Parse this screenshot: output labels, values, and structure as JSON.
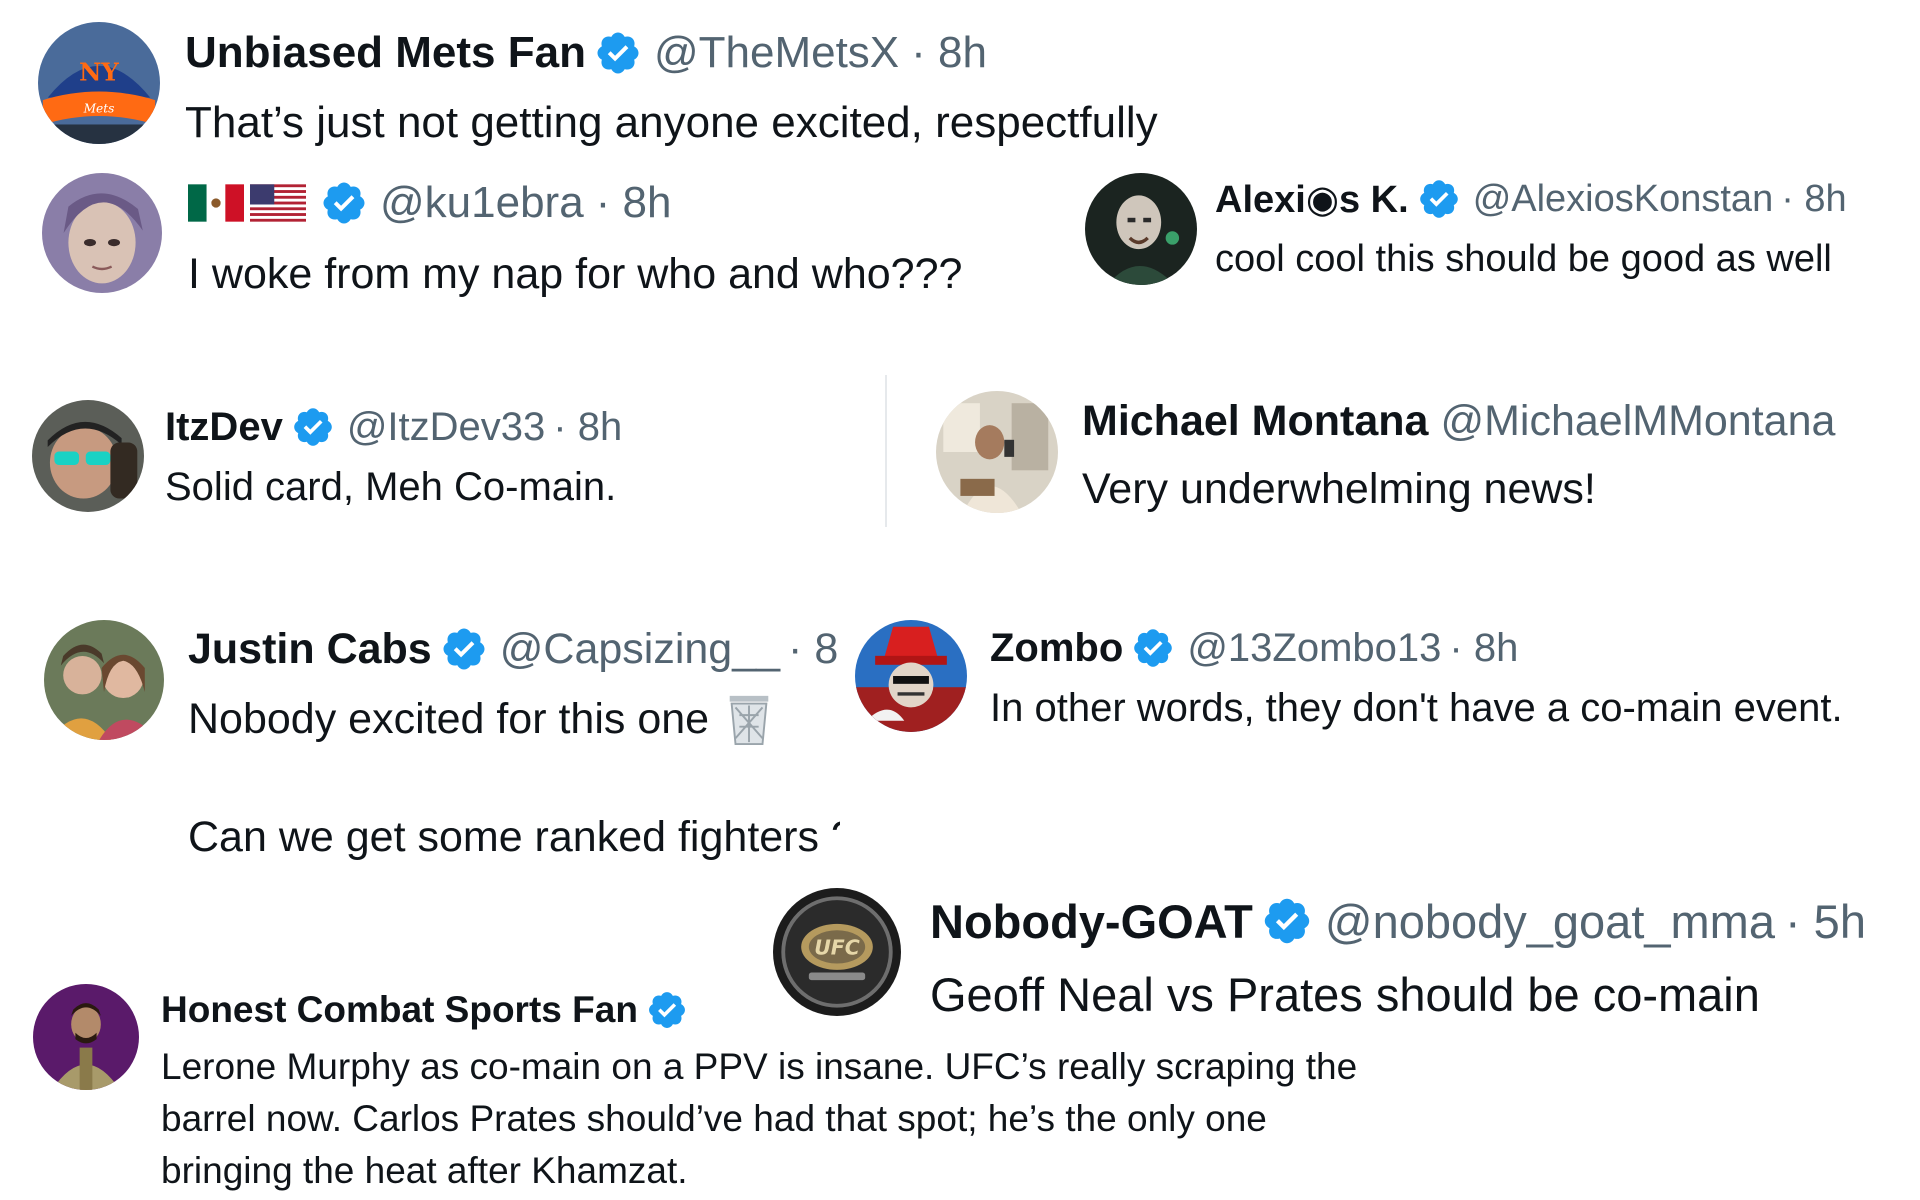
{
  "colors": {
    "verified": "#1d9bf0",
    "text": "#0f1419",
    "muted": "#536471"
  },
  "posts": [
    {
      "name": "Unbiased Mets Fan",
      "handle": "@TheMetsX",
      "time": "· 8h",
      "text": "That’s just not getting anyone excited, respectfully",
      "verified": true,
      "avatar": "mets-cap-avatar"
    },
    {
      "name": "",
      "handle": "@ku1ebra",
      "time": "· 8h",
      "text": "I woke from my nap for who and who???",
      "verified": true,
      "name_emoji": [
        "mexico-flag",
        "usa-flag"
      ],
      "avatar": "person-avatar"
    },
    {
      "name": "Alexi◉s K.",
      "handle": "@AlexiosKonstan",
      "time": "· 8h",
      "text": "cool cool this should be good as well",
      "verified": true,
      "avatar": "dark-character-avatar"
    },
    {
      "name": "ItzDev",
      "handle": "@ItzDev33",
      "time": "· 8h",
      "text": "Solid card, Meh Co-main.",
      "verified": true,
      "avatar": "sunglasses-avatar"
    },
    {
      "name": "Michael Montana",
      "handle": "@MichaelMMontana",
      "time": "",
      "text": "Very underwhelming news!",
      "verified": false,
      "avatar": "selfie-avatar"
    },
    {
      "name": "Justin Cabs",
      "handle": "@Capsizing__",
      "time": "· 8",
      "text": "Nobody excited for this one",
      "text_emoji": "wastebasket-icon",
      "text2": "Can we get some ranked fighters ?",
      "verified": true,
      "avatar": "group-avatar"
    },
    {
      "name": "Zombo",
      "handle": "@13Zombo13",
      "time": "· 8h",
      "text": "In other words, they don't have a co-main event.",
      "verified": true,
      "avatar": "red-hat-avatar"
    },
    {
      "name": "Nobody-GOAT",
      "handle": "@nobody_goat_mma",
      "time": "· 5h",
      "text": "Geoff Neal vs Prates should be co-main",
      "verified": true,
      "avatar": "ufc-belt-avatar",
      "avatar_text": "UFC"
    },
    {
      "name": "Honest Combat Sports Fan",
      "handle": "",
      "time": "",
      "text_lines": [
        "Lerone Murphy as co-main on a PPV is insane. UFC’s really scraping the",
        "barrel now. Carlos Prates should’ve had that spot; he’s the only one",
        "bringing the heat after Khamzat."
      ],
      "verified": true,
      "avatar": "fighter-avatar"
    }
  ]
}
